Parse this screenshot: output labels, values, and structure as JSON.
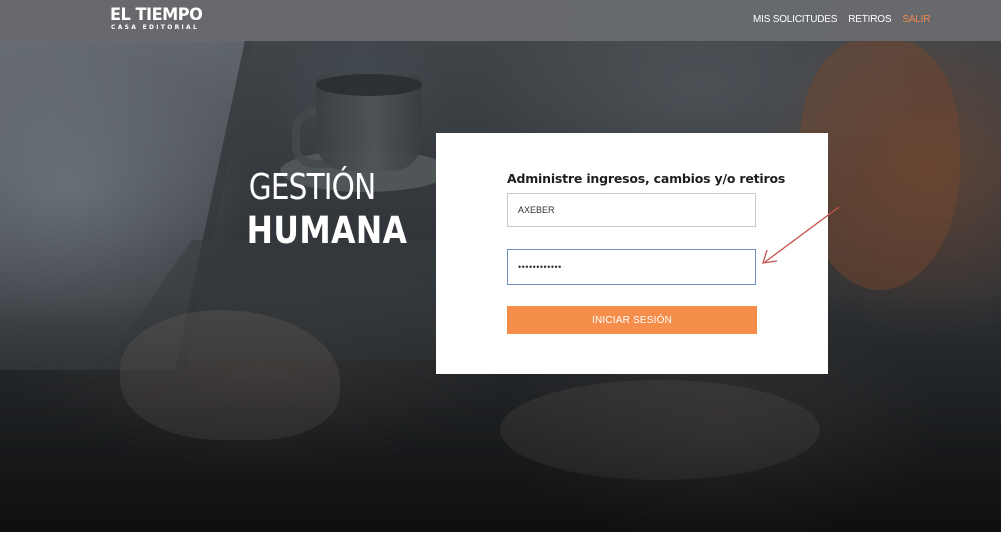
{
  "header": {
    "logo_main": "EL TIEMPO",
    "logo_sub": "CASA EDITORIAL",
    "nav": [
      {
        "label": "MIS SOLICITUDES"
      },
      {
        "label": "RETIROS"
      },
      {
        "label": "SALIR"
      }
    ]
  },
  "hero": {
    "title_line1": "GESTIÓN",
    "title_line2": "HUMANA"
  },
  "login": {
    "heading": "Administre ingresos, cambios y/o retiros",
    "username_value": "AXEBER",
    "password_value": "••••••••••••",
    "submit_label": "INICIAR SESIÓN"
  },
  "colors": {
    "accent": "#f58d4b",
    "nav_accent": "#f0884e",
    "annotation_arrow": "#c0544a"
  }
}
